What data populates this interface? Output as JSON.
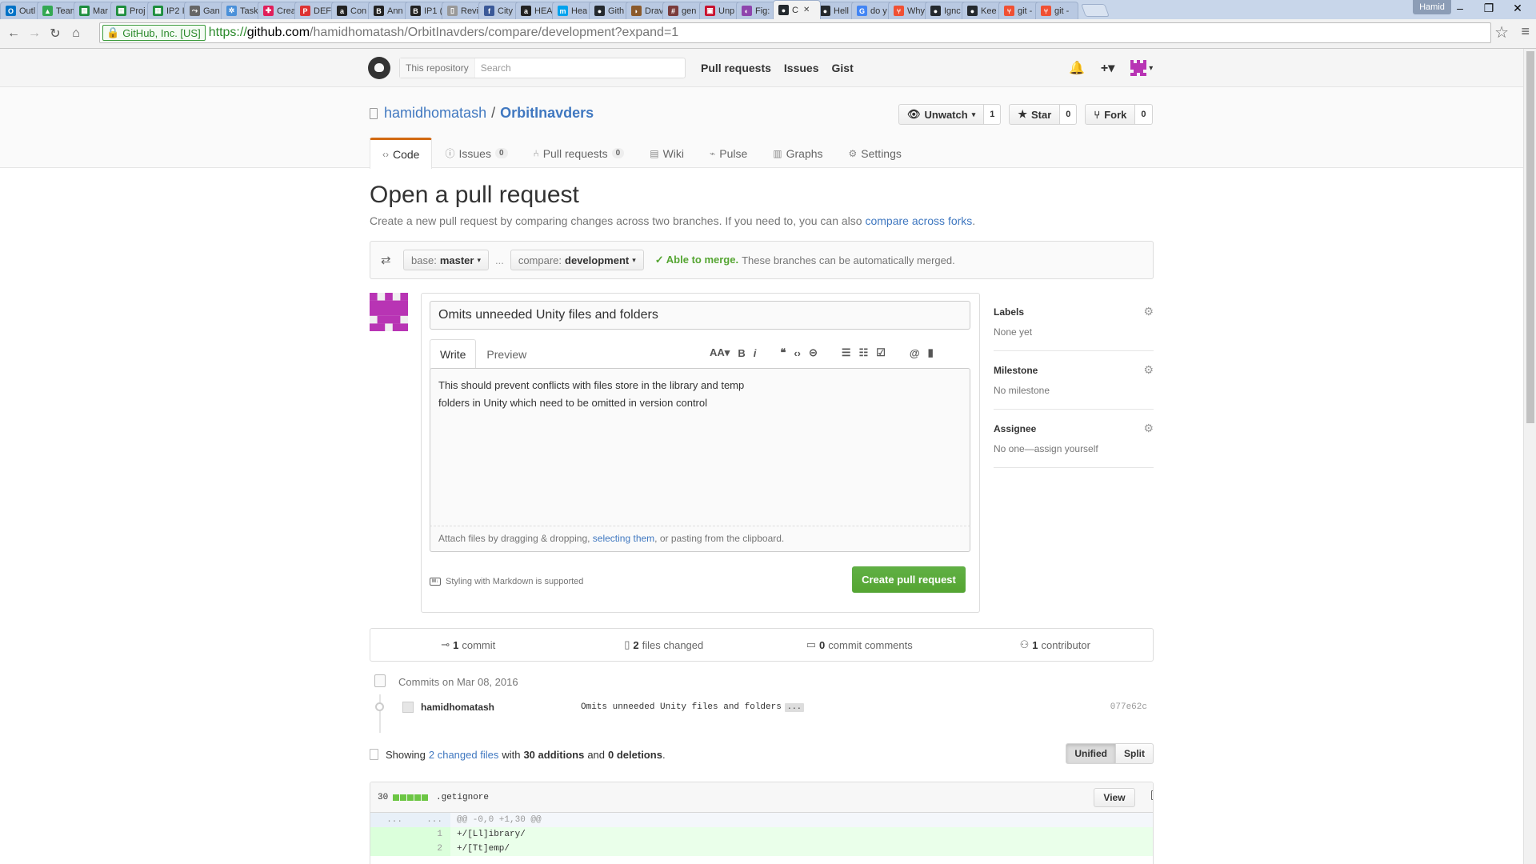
{
  "browser": {
    "tabs": [
      {
        "label": "Outl",
        "color": "#0072c6",
        "glyph": "O"
      },
      {
        "label": "Team",
        "color": "#34a853",
        "glyph": "▲"
      },
      {
        "label": "Mar",
        "color": "#1e8e3e",
        "glyph": "▦"
      },
      {
        "label": "Proj",
        "color": "#1e8e3e",
        "glyph": "▦"
      },
      {
        "label": "IP2 I",
        "color": "#1e8e3e",
        "glyph": "▦"
      },
      {
        "label": "Gan",
        "color": "#666666",
        "glyph": "⤳"
      },
      {
        "label": "Task",
        "color": "#4a90d9",
        "glyph": "✲"
      },
      {
        "label": "Crea",
        "color": "#e01e5a",
        "glyph": "✚"
      },
      {
        "label": "DEF",
        "color": "#d33",
        "glyph": "P"
      },
      {
        "label": "Con",
        "color": "#222222",
        "glyph": "a"
      },
      {
        "label": "Ann",
        "color": "#222222",
        "glyph": "B"
      },
      {
        "label": "IP1 (",
        "color": "#222222",
        "glyph": "B"
      },
      {
        "label": "Revi",
        "color": "#999999",
        "glyph": "▯"
      },
      {
        "label": "City",
        "color": "#3b5998",
        "glyph": "f"
      },
      {
        "label": "HEA",
        "color": "#222222",
        "glyph": "a"
      },
      {
        "label": "Hea",
        "color": "#00a2ed",
        "glyph": "m"
      },
      {
        "label": "Gith",
        "color": "#24292e",
        "glyph": "●"
      },
      {
        "label": "Drav",
        "color": "#8b5a2b",
        "glyph": "◗"
      },
      {
        "label": "gen",
        "color": "#7a3b3b",
        "glyph": "#"
      },
      {
        "label": "Unp",
        "color": "#c8102e",
        "glyph": "▣"
      },
      {
        "label": "Fig:",
        "color": "#8e44ad",
        "glyph": "◐"
      },
      {
        "label": "C",
        "color": "#24292e",
        "glyph": "●"
      },
      {
        "label": "Hell",
        "color": "#24292e",
        "glyph": "●"
      },
      {
        "label": "do y",
        "color": "#4285f4",
        "glyph": "G"
      },
      {
        "label": "Why",
        "color": "#f05033",
        "glyph": "⑂"
      },
      {
        "label": "Ignc",
        "color": "#24292e",
        "glyph": "●"
      },
      {
        "label": "Kee",
        "color": "#24292e",
        "glyph": "●"
      },
      {
        "label": "git -",
        "color": "#f05033",
        "glyph": "⑂"
      },
      {
        "label": "git -",
        "color": "#f05033",
        "glyph": "⑂"
      }
    ],
    "active_tab_index": 21,
    "user_label": "Hamid",
    "secure_label": "GitHub, Inc. [US]",
    "url_scheme": "https://",
    "url_host": "github.com",
    "url_path": "/hamidhomatash/OrbitInavders/compare/development?expand=1"
  },
  "github": {
    "search_scope": "This repository",
    "search_placeholder": "Search",
    "nav": [
      "Pull requests",
      "Issues",
      "Gist"
    ],
    "owner": "hamidhomatash",
    "separator": "/",
    "repo": "OrbitInavders",
    "unwatch_label": "Unwatch",
    "unwatch_count": "1",
    "star_label": "Star",
    "star_count": "0",
    "fork_label": "Fork",
    "fork_count": "0",
    "tabs": [
      {
        "label": "Code",
        "icon": "code-icon",
        "glyph": "‹›",
        "count": ""
      },
      {
        "label": "Issues",
        "icon": "issue-icon",
        "glyph": "ⓘ",
        "count": "0"
      },
      {
        "label": "Pull requests",
        "icon": "pull-request-icon",
        "glyph": "⑃",
        "count": "0"
      },
      {
        "label": "Wiki",
        "icon": "book-icon",
        "glyph": "▤",
        "count": ""
      },
      {
        "label": "Pulse",
        "icon": "pulse-icon",
        "glyph": "⌁",
        "count": ""
      },
      {
        "label": "Graphs",
        "icon": "graph-icon",
        "glyph": "▥",
        "count": ""
      },
      {
        "label": "Settings",
        "icon": "gear-icon",
        "glyph": "⚙",
        "count": ""
      }
    ]
  },
  "page": {
    "title": "Open a pull request",
    "desc_text": "Create a new pull request by comparing changes across two branches. If you need to, you can also ",
    "desc_link": "compare across forks",
    "desc_end": ".",
    "base_prefix": "base:",
    "base_branch": "master",
    "range_dots": "...",
    "compare_prefix": "compare:",
    "compare_branch": "development",
    "merge_status": "Able to merge.",
    "merge_text": "These branches can be automatically merged."
  },
  "form": {
    "title_value": "Omits unneeded Unity files and folders",
    "tab_write": "Write",
    "tab_preview": "Preview",
    "body_line1": "This should prevent conflicts with files store in the library and temp",
    "body_line2": "folders in Unity which need to be omitted in version control",
    "attach_pre": "Attach files by dragging & dropping, ",
    "attach_link": "selecting them",
    "attach_post": ", or pasting from the clipboard.",
    "markdown_note": "Styling with Markdown is supported",
    "create_button": "Create pull request"
  },
  "sidebar": [
    {
      "heading": "Labels",
      "value": "None yet"
    },
    {
      "heading": "Milestone",
      "value": "No milestone"
    },
    {
      "heading": "Assignee",
      "value": "No one—assign yourself"
    }
  ],
  "summary": {
    "commits_count": "1",
    "commits_label": "commit",
    "files_count": "2",
    "files_label": "files changed",
    "comments_count": "0",
    "comments_label": "commit comments",
    "contrib_count": "1",
    "contrib_label": "contributor"
  },
  "commits": {
    "group_heading": "Commits on Mar 08, 2016",
    "author": "hamidhomatash",
    "message": "Omits unneeded Unity files and folders",
    "ellipsis": "...",
    "sha": "077e62c"
  },
  "files": {
    "showing": "Showing",
    "changed_link": "2 changed files",
    "with": "with",
    "additions": "30 additions",
    "and": "and",
    "deletions": "0 deletions",
    "period": ".",
    "unified": "Unified",
    "split": "Split",
    "file_additions": "30",
    "file_name": ".getignore",
    "view_button": "View",
    "lines": [
      {
        "old": "...",
        "new": "...",
        "code": "@@ -0,0 +1,30 @@",
        "kind": "hunk"
      },
      {
        "old": "",
        "new": "1",
        "code": "+/[Ll]ibrary/",
        "kind": "add"
      },
      {
        "old": "",
        "new": "2",
        "code": "+/[Tt]emp/",
        "kind": "add"
      }
    ]
  }
}
